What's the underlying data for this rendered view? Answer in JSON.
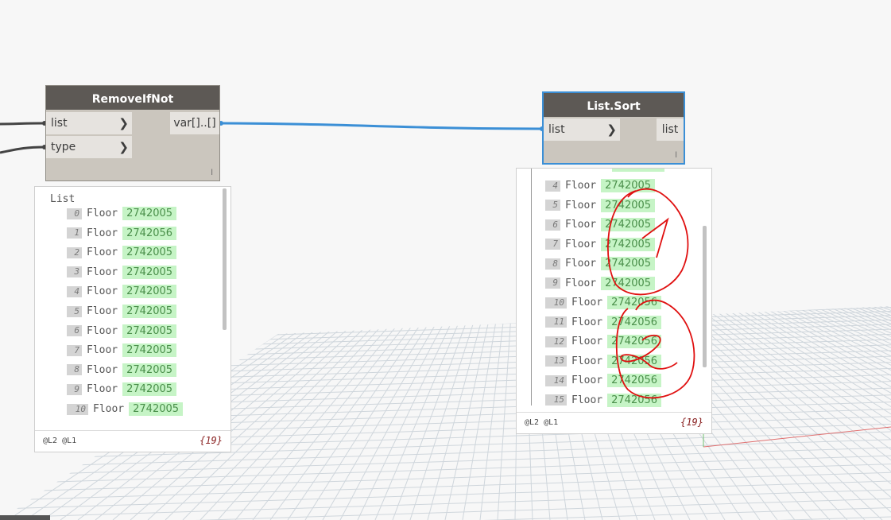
{
  "node_removeifnot": {
    "title": "RemoveIfNot",
    "inputs": [
      "list",
      "type"
    ],
    "output": "var[]..[]",
    "lacing": "l"
  },
  "node_listsort": {
    "title": "List.Sort",
    "input": "list",
    "output": "list",
    "lacing": "l"
  },
  "preview_left": {
    "header": "List",
    "item_label": "Floor",
    "rows": [
      {
        "index": "0",
        "value": "2742005"
      },
      {
        "index": "1",
        "value": "2742056"
      },
      {
        "index": "2",
        "value": "2742005"
      },
      {
        "index": "3",
        "value": "2742005"
      },
      {
        "index": "4",
        "value": "2742005"
      },
      {
        "index": "5",
        "value": "2742005"
      },
      {
        "index": "6",
        "value": "2742005"
      },
      {
        "index": "7",
        "value": "2742005"
      },
      {
        "index": "8",
        "value": "2742005"
      },
      {
        "index": "9",
        "value": "2742005"
      },
      {
        "index": "10",
        "value": "2742005"
      }
    ],
    "levels": "@L2 @L1",
    "count": "{19}"
  },
  "preview_right": {
    "item_label": "Floor",
    "rows": [
      {
        "index": "4",
        "value": "2742005"
      },
      {
        "index": "5",
        "value": "2742005"
      },
      {
        "index": "6",
        "value": "2742005"
      },
      {
        "index": "7",
        "value": "2742005"
      },
      {
        "index": "8",
        "value": "2742005"
      },
      {
        "index": "9",
        "value": "2742005"
      },
      {
        "index": "10",
        "value": "2742056"
      },
      {
        "index": "11",
        "value": "2742056"
      },
      {
        "index": "12",
        "value": "2742056"
      },
      {
        "index": "13",
        "value": "2742056"
      },
      {
        "index": "14",
        "value": "2742056"
      },
      {
        "index": "15",
        "value": "2742056"
      }
    ],
    "levels": "@L2 @L1",
    "count": "{19}"
  },
  "annotations": [
    "1",
    "2"
  ],
  "colors": {
    "wire": "#3b8fd6",
    "node_header": "#5d5955",
    "node_body": "#cbc6be",
    "selected_border": "#3b8fd6",
    "value_bg": "#c6f4c6",
    "annotation": "#e01010"
  }
}
